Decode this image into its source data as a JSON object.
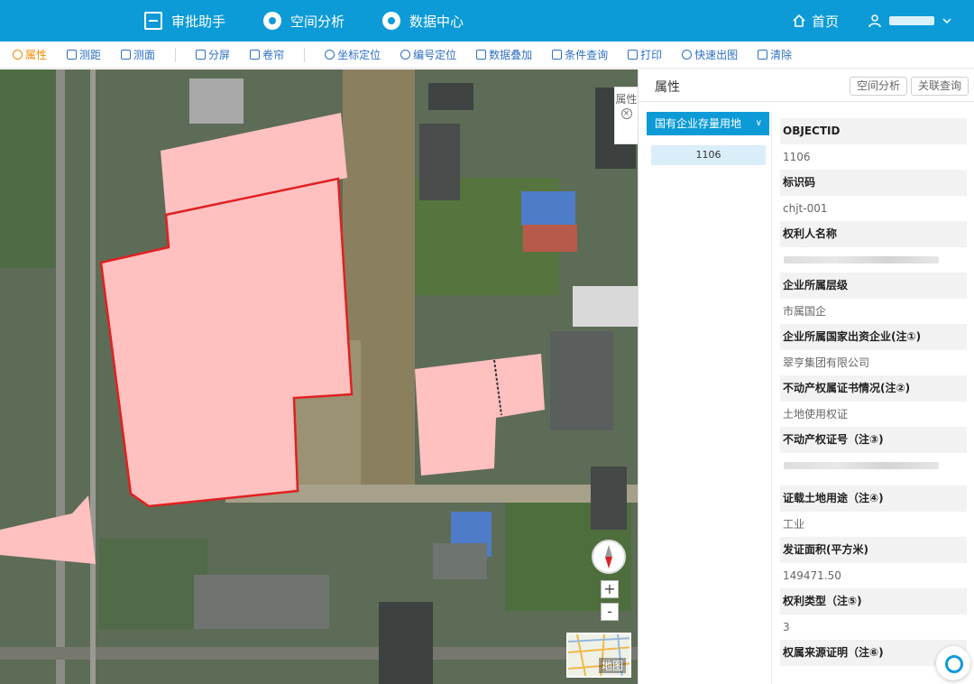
{
  "header": {
    "nav": [
      {
        "label": "审批助手"
      },
      {
        "label": "空间分析"
      },
      {
        "label": "数据中心"
      }
    ],
    "home_label": "首页"
  },
  "toolbar": {
    "items": [
      "属性",
      "测距",
      "测面",
      "分屏",
      "卷帘",
      "坐标定位",
      "编号定位",
      "数据叠加",
      "条件查询",
      "打印",
      "快速出图",
      "清除"
    ],
    "active": "属性"
  },
  "map": {
    "properties_tab": "属性",
    "zoom_in": "+",
    "zoom_out": "-",
    "minimap_label": "地图",
    "highlight_color": "#ffc0c0",
    "selected_outline_color": "#e02020"
  },
  "panel": {
    "title": "属性",
    "btn_spatial": "空间分析",
    "btn_related": "关联查询",
    "layer_name": "国有企业存量用地",
    "feature_id": "1106",
    "attributes": [
      {
        "label": "OBJECTID",
        "value": "1106"
      },
      {
        "label": "标识码",
        "value": "chjt-001"
      },
      {
        "label": "权利人名称",
        "value": ""
      },
      {
        "label": "企业所属层级",
        "value": "市属国企"
      },
      {
        "label": "企业所属国家出资企业(注①)",
        "value": "翠亨集团有限公司"
      },
      {
        "label": "不动产权属证书情况(注②)",
        "value": "土地使用权证"
      },
      {
        "label": "不动产权证号（注③)",
        "value": ""
      },
      {
        "label": "证载土地用途（注④)",
        "value": "工业"
      },
      {
        "label": "发证面积(平方米)",
        "value": "149471.50"
      },
      {
        "label": "权利类型（注⑤)",
        "value": "3"
      },
      {
        "label": "权属来源证明（注⑥)",
        "value": ""
      }
    ]
  }
}
